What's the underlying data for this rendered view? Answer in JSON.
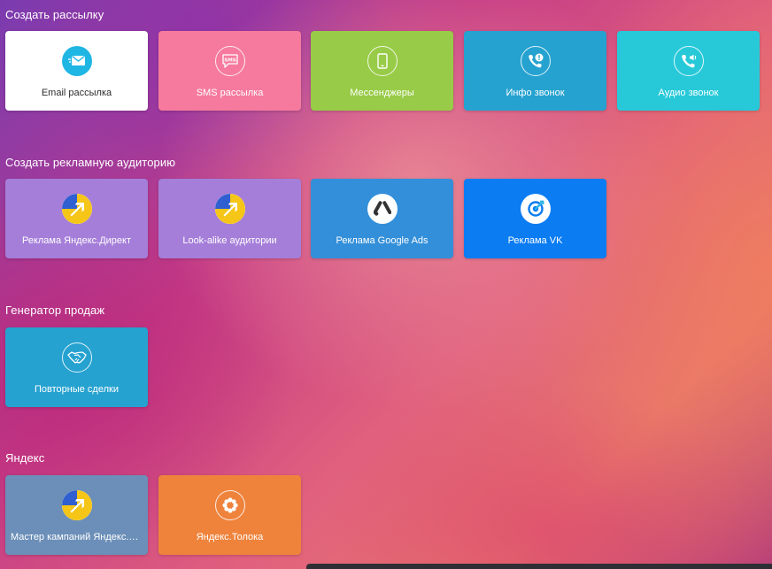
{
  "sections": [
    {
      "title": "Создать рассылку",
      "tiles": [
        {
          "label": "Email рассылка",
          "icon": "email-icon",
          "bg": "#ffffff"
        },
        {
          "label": "SMS рассылка",
          "icon": "sms-icon",
          "bg": "#f67a9e"
        },
        {
          "label": "Мессенджеры",
          "icon": "smartphone-icon",
          "bg": "#98cb47"
        },
        {
          "label": "Инфо звонок",
          "icon": "info-call-icon",
          "bg": "#26a2d0"
        },
        {
          "label": "Аудио звонок",
          "icon": "audio-call-icon",
          "bg": "#27c9d9"
        }
      ]
    },
    {
      "title": "Создать рекламную аудиторию",
      "tiles": [
        {
          "label": "Реклама Яндекс.Директ",
          "icon": "yandex-direct-icon",
          "bg": "#a57ed9"
        },
        {
          "label": "Look-alike аудитории",
          "icon": "yandex-direct-icon",
          "bg": "#a57ed9"
        },
        {
          "label": "Реклама Google Ads",
          "icon": "google-ads-icon",
          "bg": "#338fd9"
        },
        {
          "label": "Реклама VK",
          "icon": "vk-ads-icon",
          "bg": "#0b7cf2"
        }
      ]
    },
    {
      "title": "Генератор продаж",
      "tiles": [
        {
          "label": "Повторные сделки",
          "icon": "handshake-icon",
          "bg": "#26a2d0"
        }
      ]
    },
    {
      "title": "Яндекс",
      "tiles": [
        {
          "label": "Мастер кампаний Яндекс.Директ",
          "icon": "yandex-direct-icon",
          "bg": "#6b8fb8"
        },
        {
          "label": "Яндекс.Толока",
          "icon": "toloka-icon",
          "bg": "#ef833c"
        }
      ]
    }
  ]
}
